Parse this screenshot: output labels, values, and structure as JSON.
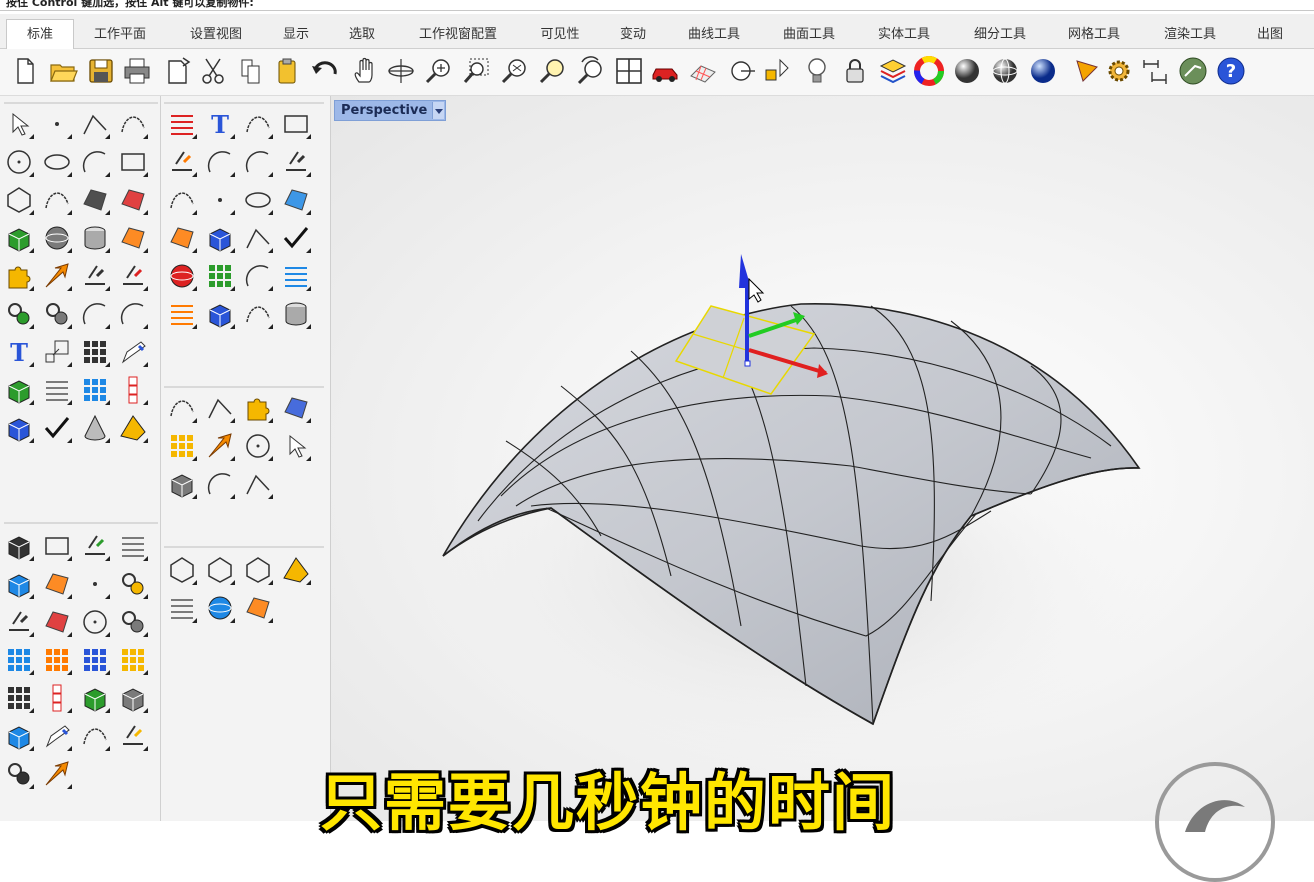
{
  "command_prompt": "按住 Control 键加选，按住 Alt 键可以复制物件:",
  "tabs": [
    {
      "label": "标准",
      "active": true
    },
    {
      "label": "工作平面",
      "active": false
    },
    {
      "label": "设置视图",
      "active": false
    },
    {
      "label": "显示",
      "active": false
    },
    {
      "label": "选取",
      "active": false
    },
    {
      "label": "工作视窗配置",
      "active": false
    },
    {
      "label": "可见性",
      "active": false
    },
    {
      "label": "变动",
      "active": false
    },
    {
      "label": "曲线工具",
      "active": false
    },
    {
      "label": "曲面工具",
      "active": false
    },
    {
      "label": "实体工具",
      "active": false
    },
    {
      "label": "细分工具",
      "active": false
    },
    {
      "label": "网格工具",
      "active": false
    },
    {
      "label": "渲染工具",
      "active": false
    },
    {
      "label": "出图",
      "active": false
    }
  ],
  "viewport": {
    "label": "Perspective"
  },
  "subtitle": "只需要几秒钟的时间",
  "colors": {
    "accent": "#9db8e8",
    "subtitle": "#ffe600",
    "gumball_z": "#2233dd",
    "gumball_x": "#e02020",
    "gumball_y": "#22cc22"
  }
}
